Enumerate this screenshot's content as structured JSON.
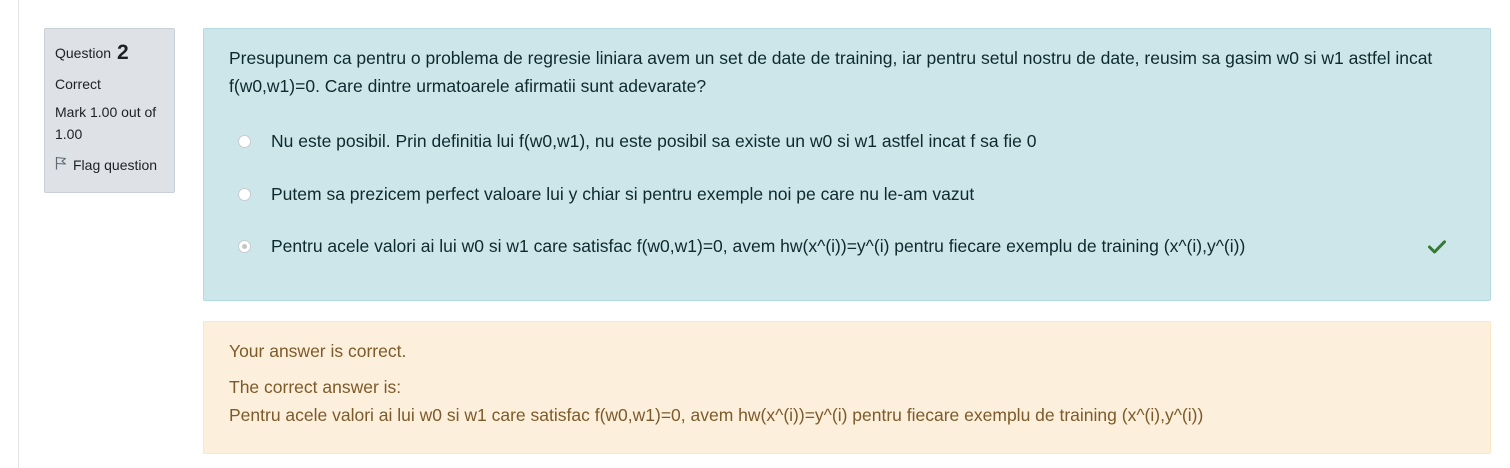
{
  "info": {
    "question_label": "Question",
    "question_number": "2",
    "state": "Correct",
    "grade": "Mark 1.00 out of 1.00",
    "flag_label": "Flag question"
  },
  "question": {
    "text": "Presupunem ca pentru o problema de regresie liniara avem un set de date de training, iar pentru setul nostru de date, reusim sa gasim w0 si w1 astfel incat f(w0,w1)=0. Care dintre urmatoarele afirmatii sunt adevarate?",
    "answers": [
      {
        "label": "Nu este posibil. Prin definitia lui f(w0,w1), nu este posibil sa existe un w0 si w1 astfel incat f sa fie 0",
        "selected": false
      },
      {
        "label": "Putem sa prezicem perfect valoare lui y chiar si pentru exemple noi pe care nu le-am vazut",
        "selected": false
      },
      {
        "label": "Pentru acele valori ai lui w0 si w1 care satisfac f(w0,w1)=0, avem hw(x^(i))=y^(i) pentru fiecare exemplu de training (x^(i),y^(i))",
        "selected": true
      }
    ]
  },
  "feedback": {
    "result": "Your answer is correct.",
    "correct_label": "The correct answer is:",
    "correct_answer": "Pentru acele valori ai lui w0 si w1 care satisfac f(w0,w1)=0, avem hw(x^(i))=y^(i) pentru fiecare exemplu de training (x^(i),y^(i))"
  },
  "colors": {
    "formulation_bg": "#cce6ea",
    "feedback_bg": "#fcefdc",
    "info_bg": "#dee2e6",
    "correct_check": "#357a32"
  },
  "icons": {
    "flag": "flag-outline-icon",
    "correct": "check-icon"
  }
}
